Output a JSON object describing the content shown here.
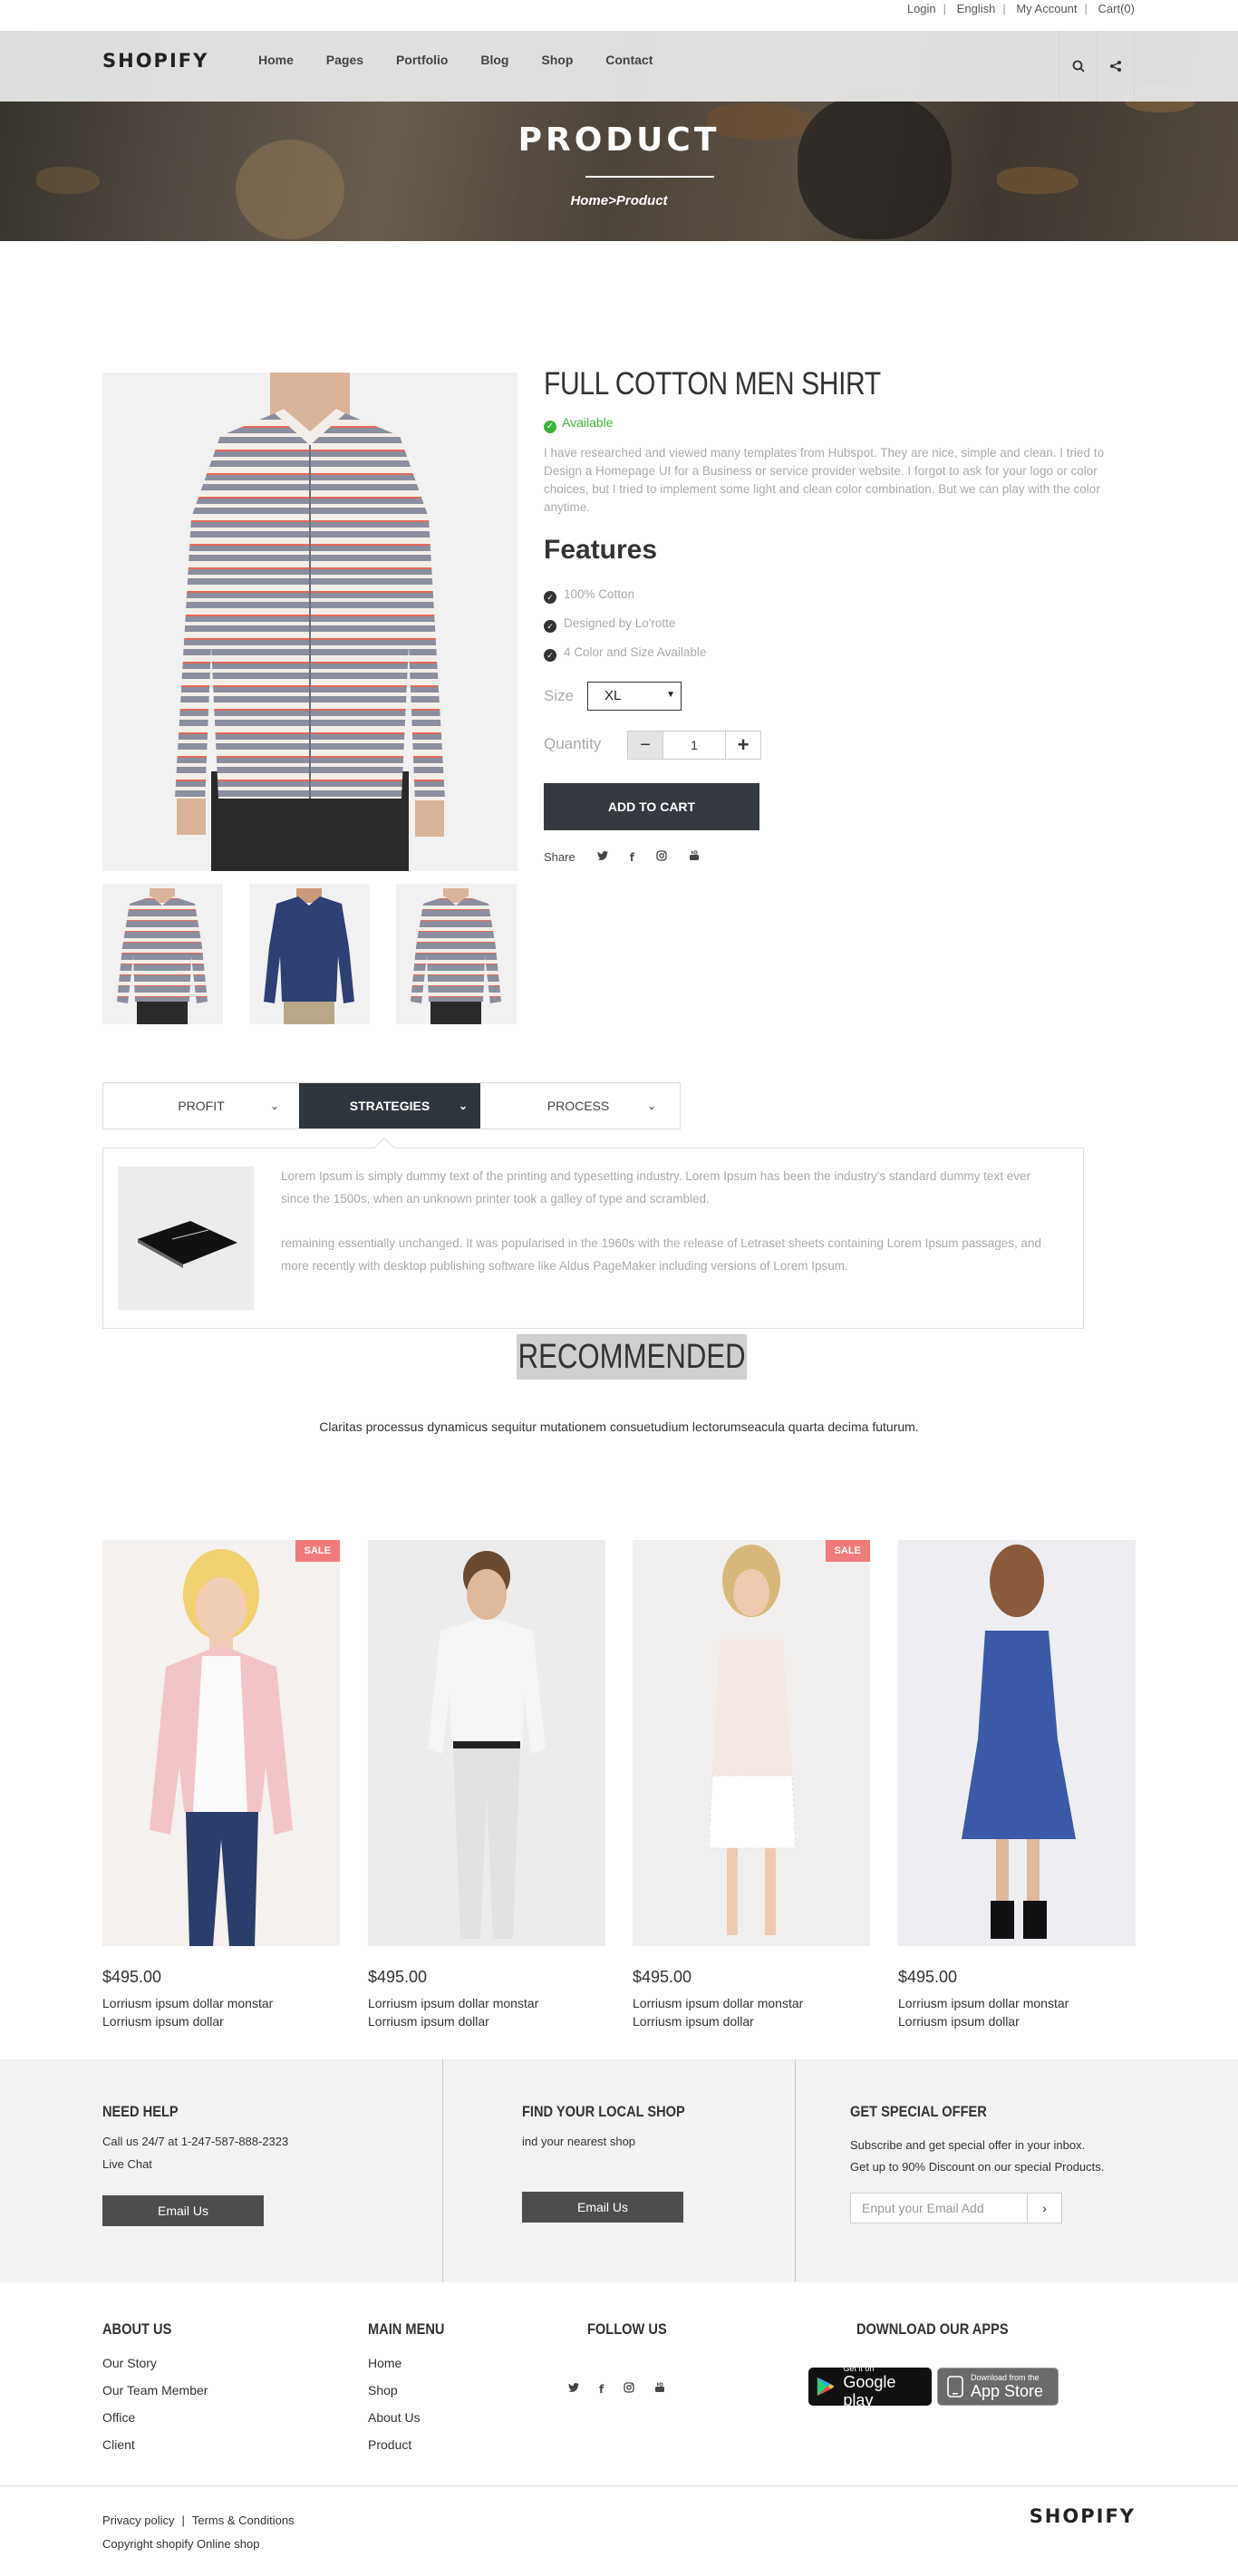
{
  "toplinks": [
    "Login",
    "English",
    "My Account",
    "Cart(0)"
  ],
  "brand": "SHOPIFY",
  "nav": [
    "Home",
    "Pages",
    "Portfolio",
    "Blog",
    "Shop",
    "Contact"
  ],
  "hero": {
    "title": "PRODUCT",
    "breadcrumb": "Home>Product"
  },
  "product": {
    "title": "FULL COTTON MEN SHIRT",
    "availability": "Available",
    "description": "I have researched and viewed many templates from Hubspot. They are nice, simple and clean. I tried to Design a Homepage UI for a Business or service provider website. I forgot to ask for your logo or color choices, but I tried to implement some light and clean color combination. But we can play with the color anytime.",
    "features_heading": "Features",
    "features": [
      "100% Cotton",
      "Designed by Lo'rotte",
      "4 Color and Size Available"
    ],
    "size_label": "Size",
    "size_value": "XL",
    "quantity_label": "Quantity",
    "quantity_value": "1",
    "add_to_cart": "ADD TO CART",
    "share_label": "Share"
  },
  "tabs": [
    "PROFIT",
    "STRATEGIES",
    "PROCESS"
  ],
  "tab_content": {
    "p1": "Lorem Ipsum is simply dummy text of the printing and typesetting industry. Lorem Ipsum has been the industry's standard dummy text ever since the 1500s, when an unknown printer took a galley of type and scrambled.",
    "p2": "remaining essentially unchanged. It was popularised in the 1960s with the release of Letraset sheets containing Lorem Ipsum passages, and more recently with desktop publishing software like Aldus PageMaker including versions of Lorem Ipsum."
  },
  "recommended": {
    "title": "RECOMMENDED",
    "subtitle": "Claritas processus dynamicus sequitur mutationem consuetudium lectorumseacula quarta decima futurum."
  },
  "products": [
    {
      "price": "$495.00",
      "line1": "Lorriusm ipsum dollar monstar",
      "line2": "Lorriusm ipsum dollar",
      "sale": "SALE"
    },
    {
      "price": "$495.00",
      "line1": "Lorriusm ipsum dollar monstar",
      "line2": "Lorriusm ipsum dollar",
      "sale": ""
    },
    {
      "price": "$495.00",
      "line1": "Lorriusm ipsum dollar monstar",
      "line2": "Lorriusm ipsum dollar",
      "sale": "SALE"
    },
    {
      "price": "$495.00",
      "line1": "Lorriusm ipsum dollar monstar",
      "line2": "Lorriusm ipsum dollar",
      "sale": ""
    }
  ],
  "help": {
    "need_help": {
      "title": "NEED HELP",
      "line1": "Call us 24/7 at 1-247-587-888-2323",
      "line2": "Live Chat",
      "button": "Email Us"
    },
    "local_shop": {
      "title": "FIND YOUR LOCAL SHOP",
      "line1": "ind your nearest shop",
      "button": "Email Us"
    },
    "offer": {
      "title": "GET SPECIAL OFFER",
      "line1": "Subscribe and get special offer in your inbox.",
      "line2": "Get up to 90% Discount on our special Products.",
      "placeholder": "Enput your Email Add"
    }
  },
  "footer": {
    "about_title": "ABOUT US",
    "about_links": [
      "Our Story",
      "Our Team Member",
      "Office",
      "Client"
    ],
    "menu_title": "MAIN MENU",
    "menu_links": [
      "Home",
      "Shop",
      "About Us",
      "Product"
    ],
    "follow_title": "FOLLOW US",
    "apps_title": "DOWNLOAD OUR APPS",
    "google_small": "Get it on",
    "google_big": "Google play",
    "apple_small": "Download from the",
    "apple_big": "App Store",
    "policy": "Privacy policy",
    "terms": "Terms & Conditions",
    "copyright": "Copyright shopify Online shop"
  },
  "colors": {
    "dark": "#2f353c",
    "sale": "#f07a7a",
    "available": "#3cb43c",
    "band": "#f2f2f2"
  },
  "icons": [
    "search-icon",
    "share-icon",
    "twitter-icon",
    "facebook-icon",
    "instagram-icon",
    "youtube-icon",
    "check-icon",
    "chevron-down-icon",
    "chevron-right-icon",
    "google-play-icon",
    "apple-icon"
  ]
}
